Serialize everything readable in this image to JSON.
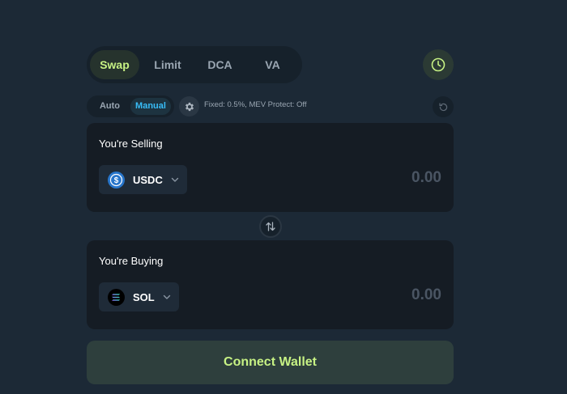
{
  "tabs": [
    {
      "label": "Swap",
      "active": true
    },
    {
      "label": "Limit",
      "active": false
    },
    {
      "label": "DCA",
      "active": false
    },
    {
      "label": "VA",
      "active": false
    }
  ],
  "mode": {
    "auto_label": "Auto",
    "manual_label": "Manual",
    "selected": "Manual"
  },
  "settings": {
    "summary": "Fixed: 0.5%, MEV Protect: Off"
  },
  "selling": {
    "label": "You're Selling",
    "token": "USDC",
    "amount_placeholder": "0.00"
  },
  "buying": {
    "label": "You're Buying",
    "token": "SOL",
    "amount_placeholder": "0.00"
  },
  "connect_button": {
    "label": "Connect Wallet"
  },
  "colors": {
    "background": "#1c2936",
    "accent_green": "#c7f284",
    "accent_blue": "#38bdf8",
    "panel": "#151c24"
  },
  "icons": [
    "history-clock-icon",
    "gear-icon",
    "refresh-icon",
    "usdc-token-icon",
    "sol-token-icon",
    "chevron-down-icon",
    "swap-arrows-icon"
  ]
}
